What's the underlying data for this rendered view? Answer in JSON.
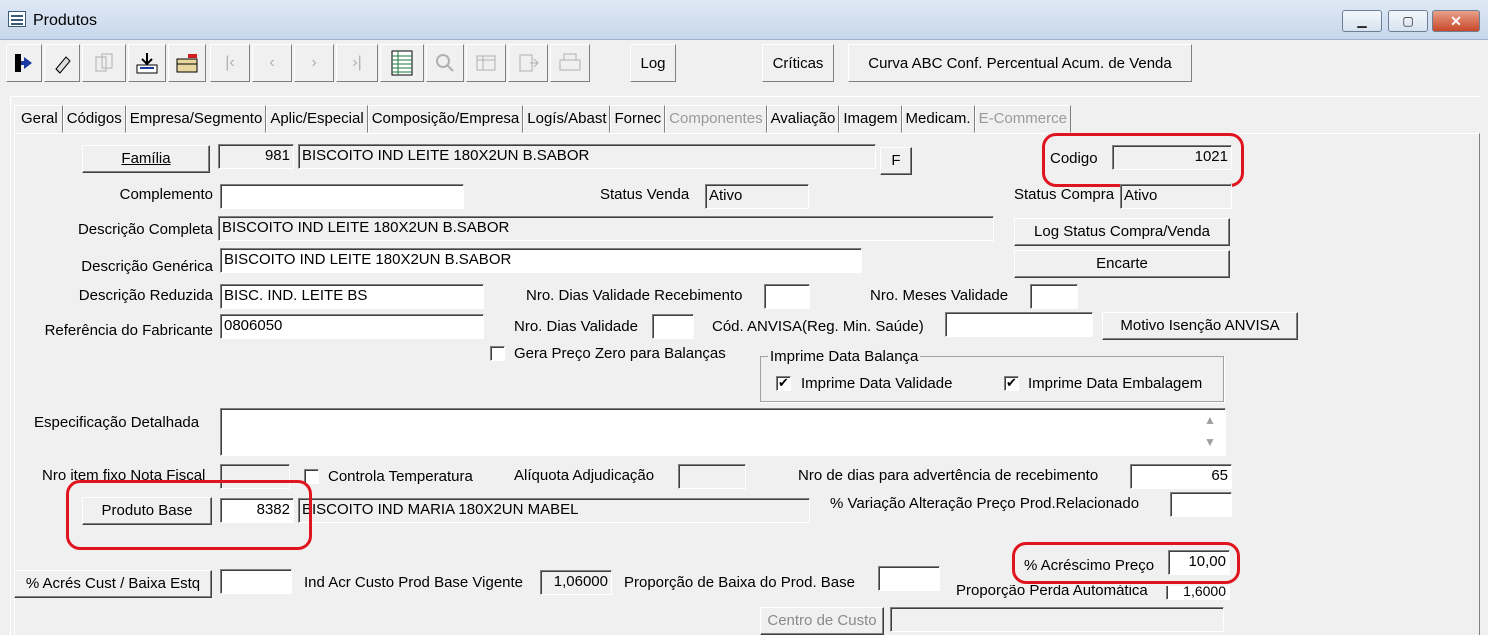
{
  "window": {
    "title": "Produtos"
  },
  "toolbar": {
    "log": "Log",
    "criticas": "Críticas",
    "curva": "Curva ABC Conf. Percentual Acum. de Venda"
  },
  "tabs": [
    "Geral",
    "Códigos",
    "Empresa/Segmento",
    "Aplic/Especial",
    "Composição/Empresa",
    "Logís/Abast",
    "Fornec",
    "Componentes",
    "Avaliação",
    "Imagem",
    "Medicam.",
    "E-Commerce"
  ],
  "form": {
    "familia_btn": "Família",
    "familia_code": "981",
    "familia_desc": "BISCOITO IND LEITE 180X2UN B.SABOR",
    "f_btn": "F",
    "codigo_label": "Codigo",
    "codigo_value": "1021",
    "complemento_label": "Complemento",
    "complemento_value": "",
    "status_venda_label": "Status Venda",
    "status_venda_value": "Ativo",
    "status_compra_label": "Status Compra",
    "status_compra_value": "Ativo",
    "desc_completa_label": "Descrição Completa",
    "desc_completa_value": "BISCOITO IND LEITE 180X2UN B.SABOR",
    "log_status_btn": "Log Status Compra/Venda",
    "desc_generica_label": "Descrição Genérica",
    "desc_generica_value": "BISCOITO IND LEITE 180X2UN B.SABOR",
    "encarte_btn": "Encarte",
    "desc_reduzida_label": "Descrição Reduzida",
    "desc_reduzida_value": "BISC. IND. LEITE BS",
    "dias_val_receb_label": "Nro. Dias Validade Recebimento",
    "meses_validade_label": "Nro. Meses Validade",
    "ref_fabricante_label": "Referência do Fabricante",
    "ref_fabricante_value": "0806050",
    "dias_validade_label": "Nro. Dias Validade",
    "anvisa_label": "Cód. ANVISA(Reg. Min. Saúde)",
    "motivo_anvisa_btn": "Motivo Isenção ANVISA",
    "gera_preco_zero_label": "Gera Preço Zero para Balanças",
    "imprime_group_label": "Imprime Data Balança",
    "imprime_validade_label": "Imprime Data Validade",
    "imprime_embalagem_label": "Imprime Data Embalagem",
    "espec_label": "Especificação Detalhada",
    "nro_item_label": "Nro item fixo Nota Fiscal",
    "controla_temp_label": "Controla Temperatura",
    "aliquota_label": "Alíquota Adjudicação",
    "dias_advert_label": "Nro de dias para advertência de recebimento",
    "dias_advert_value": "65",
    "produto_base_btn": "Produto Base",
    "produto_base_code": "8382",
    "produto_base_desc": "BISCOITO IND MARIA 180X2UN MABEL",
    "variacao_label": "% Variação Alteração Preço Prod.Relacionado",
    "acrescimo_label": "% Acréscimo Preço",
    "acrescimo_value": "10,00",
    "acres_cust_btn": "% Acrés Cust / Baixa Estq",
    "ind_acr_label": "Ind Acr Custo Prod Base Vigente",
    "ind_acr_value": "1,06000",
    "proporcao_baixa_label": "Proporção de Baixa do Prod. Base",
    "proporcao_perda_label": "Proporção Perda Automática",
    "proporcao_perda_value": "1,6000",
    "centro_custo_btn": "Centro de Custo"
  }
}
